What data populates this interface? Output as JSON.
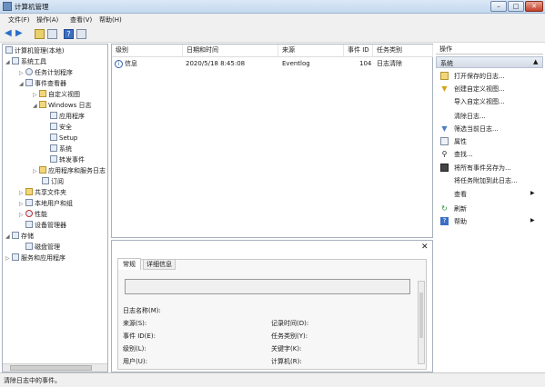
{
  "window": {
    "title": "计算机管理",
    "buttons": {
      "minimize": "–",
      "maximize": "□",
      "close": "✕"
    }
  },
  "menu": [
    "文件(F)",
    "操作(A)",
    "查看(V)",
    "帮助(H)"
  ],
  "tree": {
    "root": "计算机管理(本地)",
    "system_tools": "系统工具",
    "task_scheduler": "任务计划程序",
    "event_viewer": "事件查看器",
    "custom_views": "自定义视图",
    "windows_logs": "Windows 日志",
    "app_log": "应用程序",
    "security": "安全",
    "setup": "Setup",
    "system": "系统",
    "forwarded": "转发事件",
    "app_service_logs": "应用程序和服务日志",
    "subscriptions": "订阅",
    "shared_folders": "共享文件夹",
    "local_users": "本地用户和组",
    "performance": "性能",
    "device_manager": "设备管理器",
    "storage": "存储",
    "disk_mgmt": "磁盘管理",
    "services_apps": "服务和应用程序"
  },
  "events": {
    "headers": [
      "级别",
      "日期和时间",
      "来源",
      "事件 ID",
      "任务类别"
    ],
    "rows": [
      {
        "level": "信息",
        "datetime": "2020/5/18 8:45:08",
        "source": "Eventlog",
        "id": "104",
        "category": "日志清除"
      }
    ]
  },
  "details": {
    "tabs": [
      "常规",
      "详细信息"
    ],
    "fields_left": [
      "日志名称(M):",
      "来源(S):",
      "事件 ID(E):",
      "级别(L):",
      "用户(U):"
    ],
    "fields_right": [
      "记录时间(D):",
      "任务类别(Y):",
      "关键字(K):",
      "计算机(R):"
    ]
  },
  "actions": {
    "title": "操作",
    "section": "系统",
    "items": [
      "打开保存的日志...",
      "创建自定义视图...",
      "导入自定义视图...",
      "清除日志...",
      "筛选当前日志...",
      "属性",
      "查找...",
      "将所有事件另存为...",
      "将任务附加到此日志...",
      "查看",
      "刷新",
      "帮助"
    ]
  },
  "status": "清除日志中的事件。"
}
